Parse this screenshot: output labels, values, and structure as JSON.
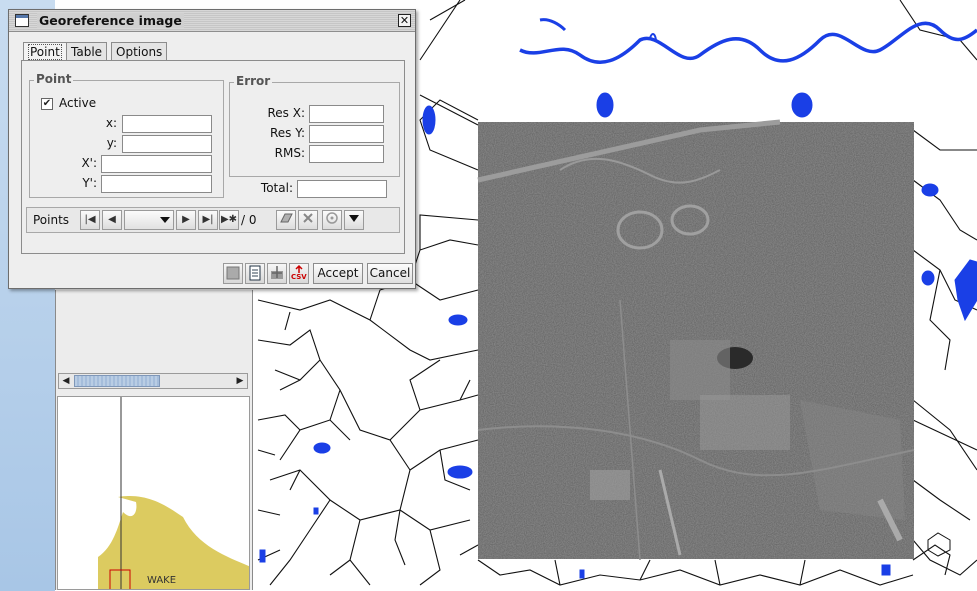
{
  "dialog": {
    "title": "Georeference image",
    "close_glyph": "✕",
    "tabs": [
      {
        "label": "Point",
        "active": true
      },
      {
        "label": "Table",
        "active": false
      },
      {
        "label": "Options",
        "active": false
      }
    ],
    "point_group": {
      "title": "Point",
      "active_label": "Active",
      "active_checked": true,
      "x_label": "x:",
      "y_label": "y:",
      "X_label": "X':",
      "Y_label": "Y':",
      "x_value": "",
      "y_value": "",
      "X_value": "",
      "Y_value": ""
    },
    "error_group": {
      "title": "Error",
      "resx_label": "Res X:",
      "resy_label": "Res Y:",
      "rms_label": "RMS:",
      "resx_value": "",
      "resy_value": "",
      "rms_value": ""
    },
    "total_label": "Total:",
    "total_value": "",
    "points_nav": {
      "label": "Points",
      "count_text": "/ 0",
      "selected_value": ""
    },
    "buttons": {
      "accept": "Accept",
      "cancel": "Cancel",
      "csv_icon_text": "CSV"
    }
  },
  "overview": {
    "region_label": "WAKE"
  },
  "colors": {
    "water": "#1a3fe6",
    "road": "#111111",
    "county": "#dccb60",
    "dialog_bg": "#eeeeee",
    "csv_red": "#cc0000"
  },
  "icons": [
    "checkbox-checked-icon",
    "first-icon",
    "prev-icon",
    "next-icon",
    "last-icon",
    "new-point-icon",
    "eraser-icon",
    "delete-icon",
    "center-icon",
    "dropdown-icon",
    "save-icon",
    "document-icon",
    "georef-icon",
    "csv-export-icon",
    "close-icon",
    "window-icon"
  ]
}
